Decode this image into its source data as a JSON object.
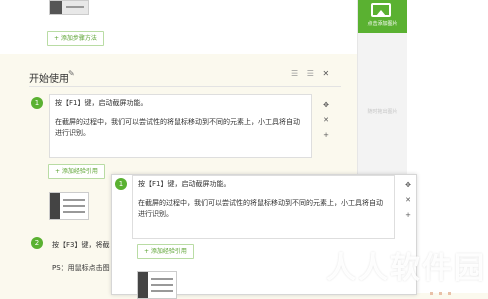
{
  "top": {
    "add_step_method": "+ 添加步骤方法"
  },
  "sidebar": {
    "add_image_label": "点击添加图片",
    "image_hint": "随时拖出图片"
  },
  "section": {
    "title": "开始使用"
  },
  "steps": [
    {
      "number": "1",
      "line1": "按【F1】键，启动截屏功能。",
      "line2": "在截屏的过程中，我们可以尝试性的将鼠标移动到不同的元素上，小工具将自动进行识别。",
      "add_tip": "+ 添加经验引用"
    },
    {
      "number": "2",
      "line1": "按【F3】键，将截",
      "ps": "PS：用鼠标点击图"
    }
  ],
  "popup": {
    "number": "1",
    "line1": "按【F1】键，启动截屏功能。",
    "line2": "在截屏的过程中，我们可以尝试性的将鼠标移动到不同的元素上，小工具将自动进行识别。",
    "add_tip": "+ 添加经验引用"
  },
  "watermark": "人人软件园",
  "colors": {
    "accent": "#5ab131",
    "background": "#fbf9ee"
  },
  "icons": [
    "move-icon",
    "close-icon",
    "add-icon",
    "pencil-icon",
    "list-icon",
    "image-icon"
  ]
}
